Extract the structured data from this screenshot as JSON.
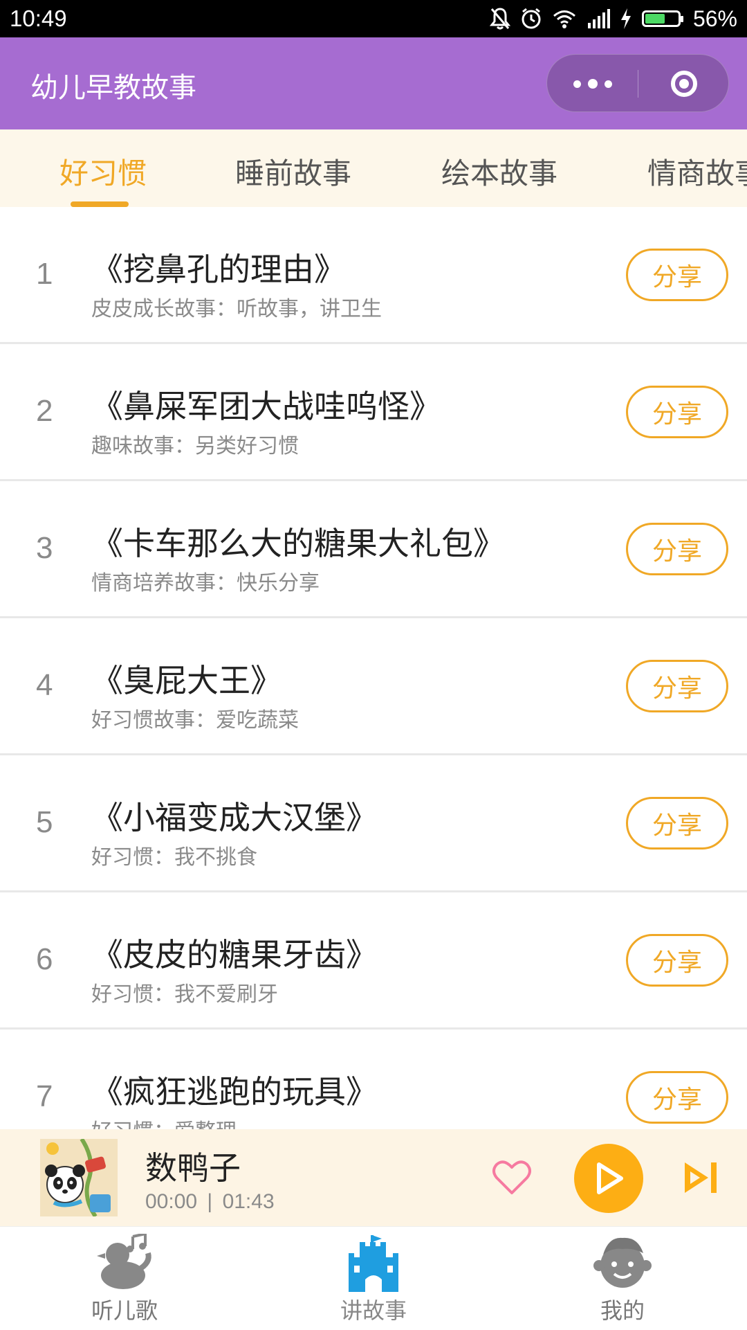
{
  "status_bar": {
    "time": "10:49",
    "battery_percent": "56%",
    "battery_level": 0.56,
    "icons": [
      "mute-bell-icon",
      "alarm-icon",
      "wifi-icon",
      "signal-icon",
      "charging-icon",
      "battery-icon"
    ]
  },
  "app_bar": {
    "title": "幼儿早教故事",
    "background_color": "#a66cd1"
  },
  "tabs": [
    {
      "label": "好习惯",
      "active": true
    },
    {
      "label": "睡前故事",
      "active": false
    },
    {
      "label": "绘本故事",
      "active": false
    },
    {
      "label": "情商故事",
      "active": false
    }
  ],
  "accent_color": "#f0a826",
  "stories": [
    {
      "num": "1",
      "title": "《挖鼻孔的理由》",
      "subtitle": "皮皮成长故事：听故事，讲卫生",
      "share": "分享"
    },
    {
      "num": "2",
      "title": "《鼻屎军团大战哇呜怪》",
      "subtitle": "趣味故事：另类好习惯",
      "share": "分享"
    },
    {
      "num": "3",
      "title": "《卡车那么大的糖果大礼包》",
      "subtitle": "情商培养故事：快乐分享",
      "share": "分享"
    },
    {
      "num": "4",
      "title": "《臭屁大王》",
      "subtitle": "好习惯故事：爱吃蔬菜",
      "share": "分享"
    },
    {
      "num": "5",
      "title": "《小福变成大汉堡》",
      "subtitle": "好习惯：我不挑食",
      "share": "分享"
    },
    {
      "num": "6",
      "title": "《皮皮的糖果牙齿》",
      "subtitle": "好习惯：我不爱刷牙",
      "share": "分享"
    },
    {
      "num": "7",
      "title": "《疯狂逃跑的玩具》",
      "subtitle": "好习惯：爱整理",
      "share": "分享"
    }
  ],
  "player": {
    "song_title": "数鸭子",
    "current_time": "00:00",
    "separator": "|",
    "duration": "01:43",
    "play_color": "#fdae14"
  },
  "bottom_nav": [
    {
      "label": "听儿歌",
      "icon": "duck-music-icon",
      "active": false
    },
    {
      "label": "讲故事",
      "icon": "castle-icon",
      "active": true
    },
    {
      "label": "我的",
      "icon": "face-icon",
      "active": false
    }
  ]
}
